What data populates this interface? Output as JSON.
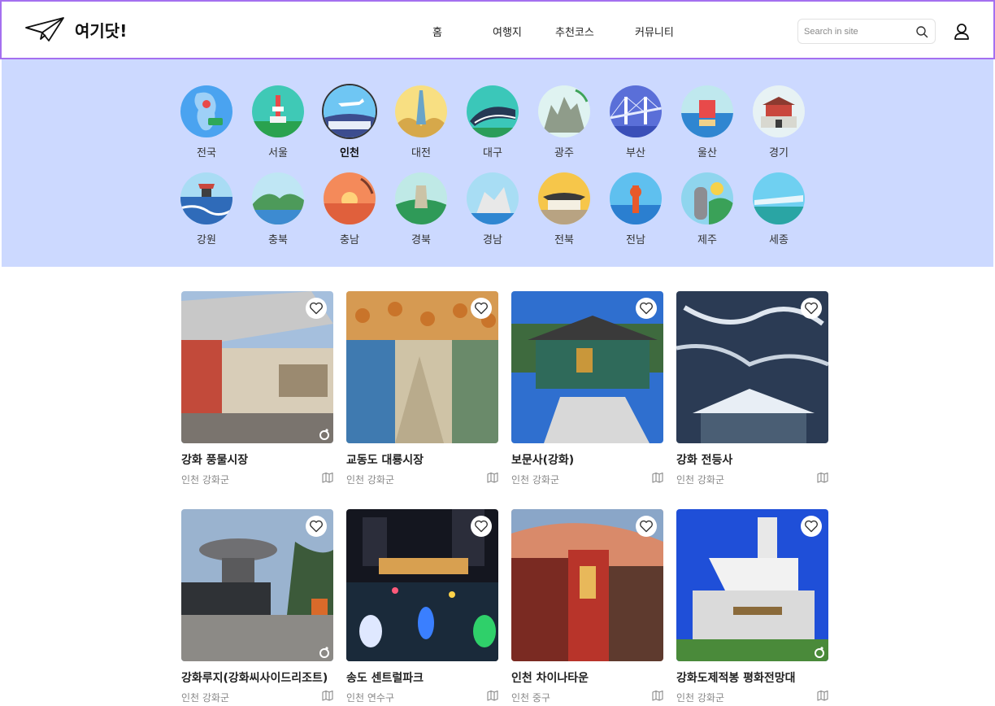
{
  "header": {
    "logo_text": "여기닷!",
    "nav": [
      "홈",
      "여행지",
      "추천코스",
      "커뮤니티"
    ],
    "search_placeholder": "Search in site"
  },
  "regions": [
    {
      "label": "전국",
      "active": false
    },
    {
      "label": "서울",
      "active": false
    },
    {
      "label": "인천",
      "active": true
    },
    {
      "label": "대전",
      "active": false
    },
    {
      "label": "대구",
      "active": false
    },
    {
      "label": "광주",
      "active": false
    },
    {
      "label": "부산",
      "active": false
    },
    {
      "label": "울산",
      "active": false
    },
    {
      "label": "경기",
      "active": false
    },
    {
      "label": "강원",
      "active": false
    },
    {
      "label": "충북",
      "active": false
    },
    {
      "label": "충남",
      "active": false
    },
    {
      "label": "경북",
      "active": false
    },
    {
      "label": "경남",
      "active": false
    },
    {
      "label": "전북",
      "active": false
    },
    {
      "label": "전남",
      "active": false
    },
    {
      "label": "제주",
      "active": false
    },
    {
      "label": "세종",
      "active": false
    }
  ],
  "places": [
    {
      "title": "강화 풍물시장",
      "location": "인천 강화군"
    },
    {
      "title": "교동도 대룡시장",
      "location": "인천 강화군"
    },
    {
      "title": "보문사(강화)",
      "location": "인천 강화군"
    },
    {
      "title": "강화 전등사",
      "location": "인천 강화군"
    },
    {
      "title": "강화루지(강화씨사이드리조트)",
      "location": "인천 강화군"
    },
    {
      "title": "송도 센트럴파크",
      "location": "인천 연수구"
    },
    {
      "title": "인천 차이나타운",
      "location": "인천 중구"
    },
    {
      "title": "강화도제적봉 평화전망대",
      "location": "인천 강화군"
    }
  ]
}
